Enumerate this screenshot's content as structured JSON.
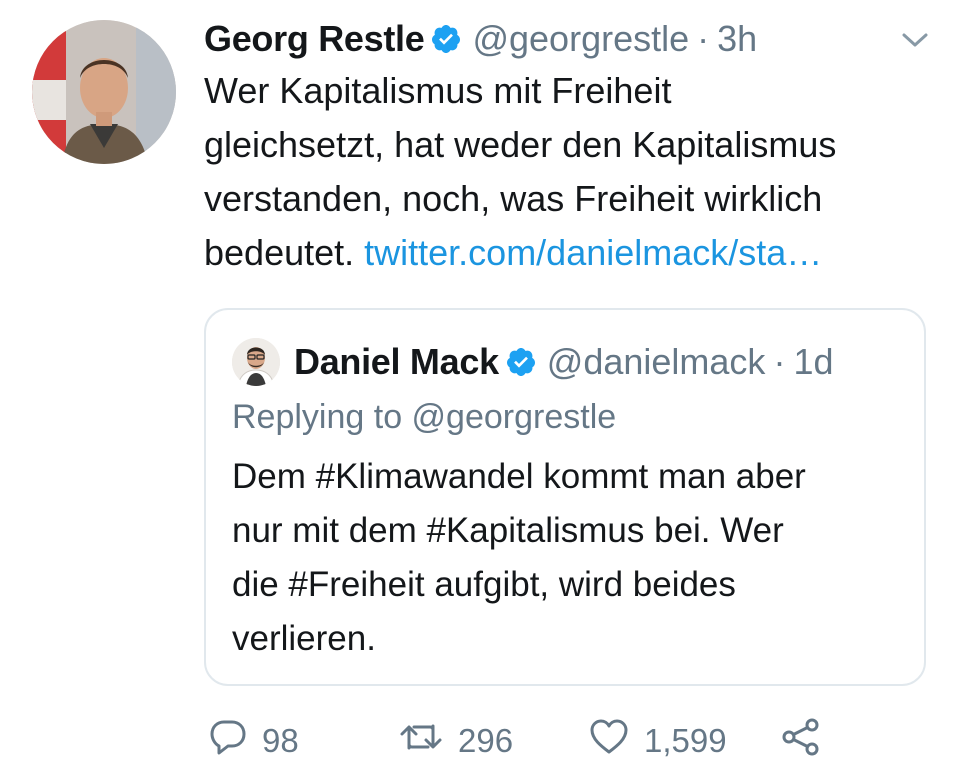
{
  "tweet": {
    "author_name": "Georg Restle",
    "author_handle": "@georgrestle",
    "separator": "·",
    "time": "3h",
    "text_lines": [
      "Wer Kapitalismus mit Freiheit",
      "gleichsetzt, hat weder den Kapitalismus",
      "verstanden, noch, was Freiheit wirklich"
    ],
    "text_last_prefix": "bedeutet. ",
    "link_text": "twitter.com/danielmack/sta…"
  },
  "quote": {
    "author_name": "Daniel Mack",
    "author_handle": "@danielmack",
    "separator": "·",
    "time": "1d",
    "replying_to": "Replying to @georgrestle",
    "text_lines": [
      "Dem #Klimawandel kommt man aber",
      "nur mit dem #Kapitalismus bei. Wer",
      "die #Freiheit aufgibt, wird beides",
      "verlieren."
    ]
  },
  "actions": {
    "replies": "98",
    "retweets": "296",
    "likes": "1,599"
  },
  "colors": {
    "text": "#14171a",
    "muted": "#657786",
    "link": "#1b95e0",
    "verified": "#1da1f2",
    "border": "#e1e8ed"
  },
  "icons": {
    "verified": "verified-badge-icon",
    "caret": "chevron-down-icon",
    "reply": "reply-icon",
    "retweet": "retweet-icon",
    "like": "heart-icon",
    "share": "share-icon"
  }
}
